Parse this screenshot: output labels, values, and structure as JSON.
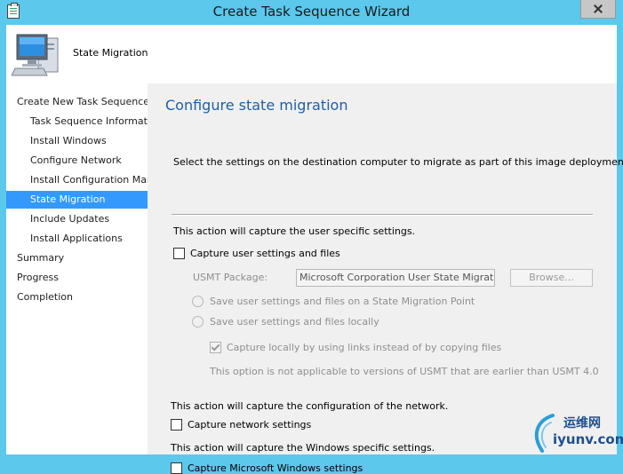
{
  "window": {
    "title": "Create Task Sequence Wizard"
  },
  "header": {
    "title": "State Migration"
  },
  "sidebar": {
    "items": [
      {
        "label": "Create New Task Sequence"
      },
      {
        "label": "Task Sequence Information"
      },
      {
        "label": "Install Windows"
      },
      {
        "label": "Configure Network"
      },
      {
        "label": "Install Configuration Manager"
      },
      {
        "label": "State Migration"
      },
      {
        "label": "Include Updates"
      },
      {
        "label": "Install Applications"
      },
      {
        "label": "Summary"
      },
      {
        "label": "Progress"
      },
      {
        "label": "Completion"
      }
    ],
    "active_index": 5
  },
  "main": {
    "heading": "Configure state migration",
    "intro": "Select the settings on the destination computer to migrate as part of this image deployment.",
    "user_section": {
      "description": "This action will capture the user specific settings.",
      "capture_checkbox": {
        "label": "Capture user settings and files",
        "checked": false
      },
      "usmt_label": "USMT Package:",
      "usmt_value": "Microsoft Corporation User State Migration Tool",
      "browse_label": "Browse...",
      "radio_smp": {
        "label": "Save user settings and files on a State Migration Point",
        "selected": false
      },
      "radio_local": {
        "label": "Save user settings and files locally",
        "selected": false
      },
      "links_checkbox": {
        "label": "Capture locally by using links instead of by copying files",
        "checked": true
      },
      "note": "This option is not applicable to versions of USMT that are earlier than USMT 4.0"
    },
    "network_section": {
      "description": "This action will capture the configuration of the network.",
      "capture_checkbox": {
        "label": "Capture network settings",
        "checked": false
      }
    },
    "windows_section": {
      "description": "This action will capture the Windows specific settings.",
      "capture_checkbox": {
        "label": "Capture Microsoft Windows settings",
        "checked": false
      }
    }
  },
  "watermark": {
    "chinese": "运维网",
    "domain": "iyunv.com"
  },
  "colors": {
    "title_bar": "#5bc8ec",
    "heading": "#1e5fa8",
    "selection": "#3399ff"
  }
}
